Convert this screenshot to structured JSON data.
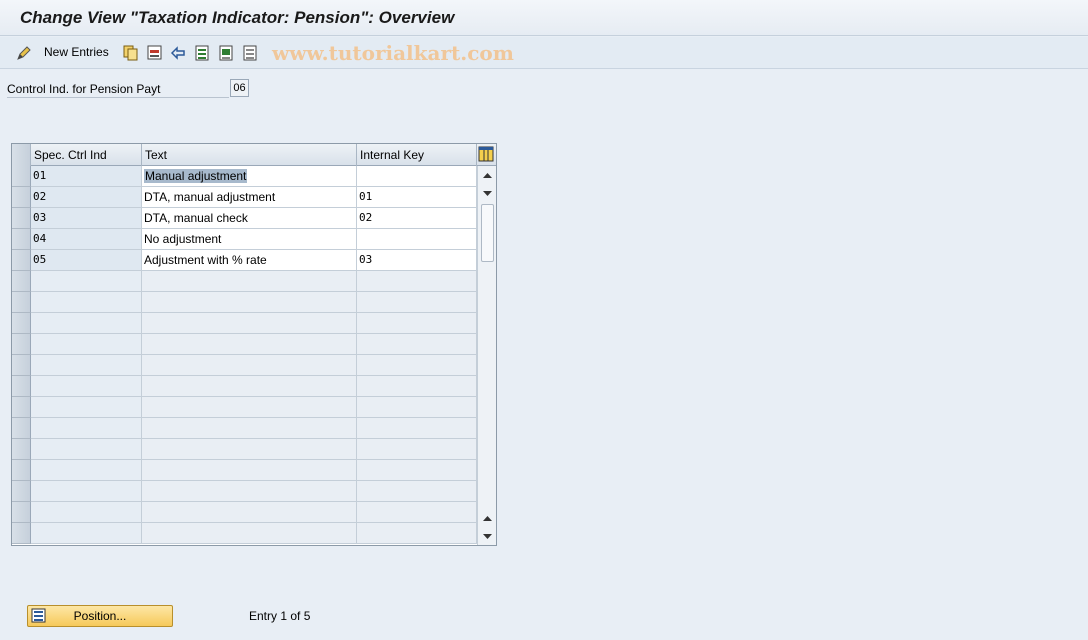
{
  "window": {
    "title": "Change View \"Taxation Indicator: Pension\": Overview"
  },
  "toolbar": {
    "new_entries_label": "New Entries",
    "icons": [
      "edit-icon",
      "copy-icon",
      "delete-icon",
      "undo-icon",
      "select-all-icon",
      "select-block-icon",
      "deselect-all-icon"
    ],
    "watermark": "www.tutorialkart.com"
  },
  "control": {
    "label": "Control Ind. for Pension Payt",
    "value": "06"
  },
  "table": {
    "columns": [
      "Spec. Ctrl Ind",
      "Text",
      "Internal Key"
    ],
    "rows": [
      {
        "spec": "01",
        "text": "Manual adjustment",
        "key": ""
      },
      {
        "spec": "02",
        "text": "DTA, manual adjustment",
        "key": "01"
      },
      {
        "spec": "03",
        "text": "DTA, manual check",
        "key": "02"
      },
      {
        "spec": "04",
        "text": "No adjustment",
        "key": ""
      },
      {
        "spec": "05",
        "text": "Adjustment with % rate",
        "key": "03"
      }
    ],
    "selected_row": 0
  },
  "footer": {
    "position_label": "Position...",
    "entry_info": "Entry 1 of 5"
  },
  "colors": {
    "accent": "#f6c95a",
    "selection": "#a7b9cc",
    "watermark": "#f0c79a"
  }
}
